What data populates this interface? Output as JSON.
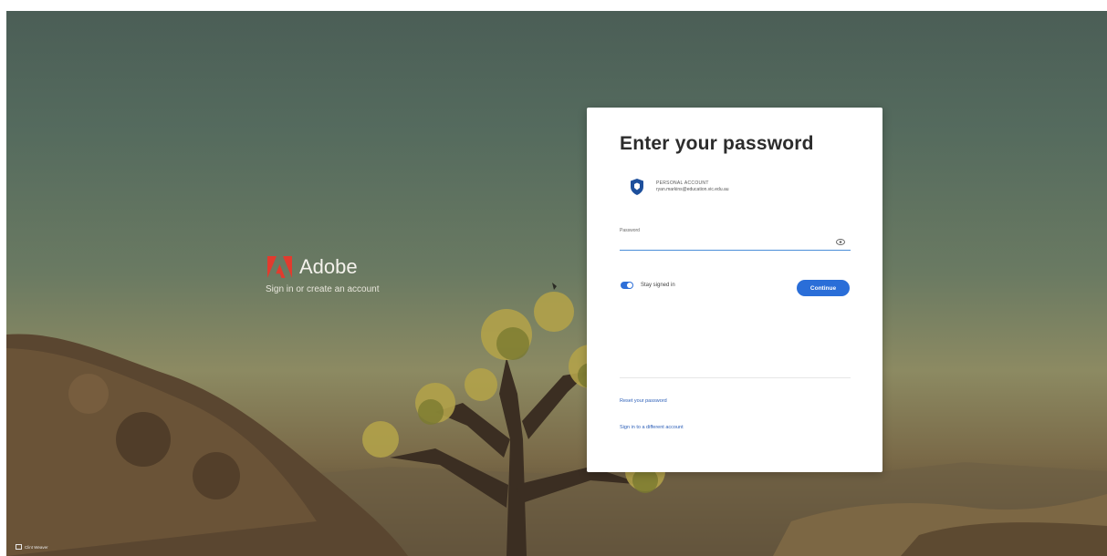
{
  "brand": {
    "name": "Adobe",
    "subtitle": "Sign in or create an account",
    "logo_color": "#e23b2e"
  },
  "card": {
    "title": "Enter your password",
    "account_type": "Personal account",
    "account_email": "ryan.markins@education.vic.edu.au",
    "password_label": "Password",
    "password_value": "",
    "stay_signed_in_label": "Stay signed in",
    "stay_signed_in_on": true,
    "continue_label": "Continue",
    "reset_password_link": "Reset your password",
    "different_account_link": "Sign in to a different account",
    "accent_color": "#2a6ed8"
  },
  "footer": {
    "credit": "Clint Weaver"
  }
}
